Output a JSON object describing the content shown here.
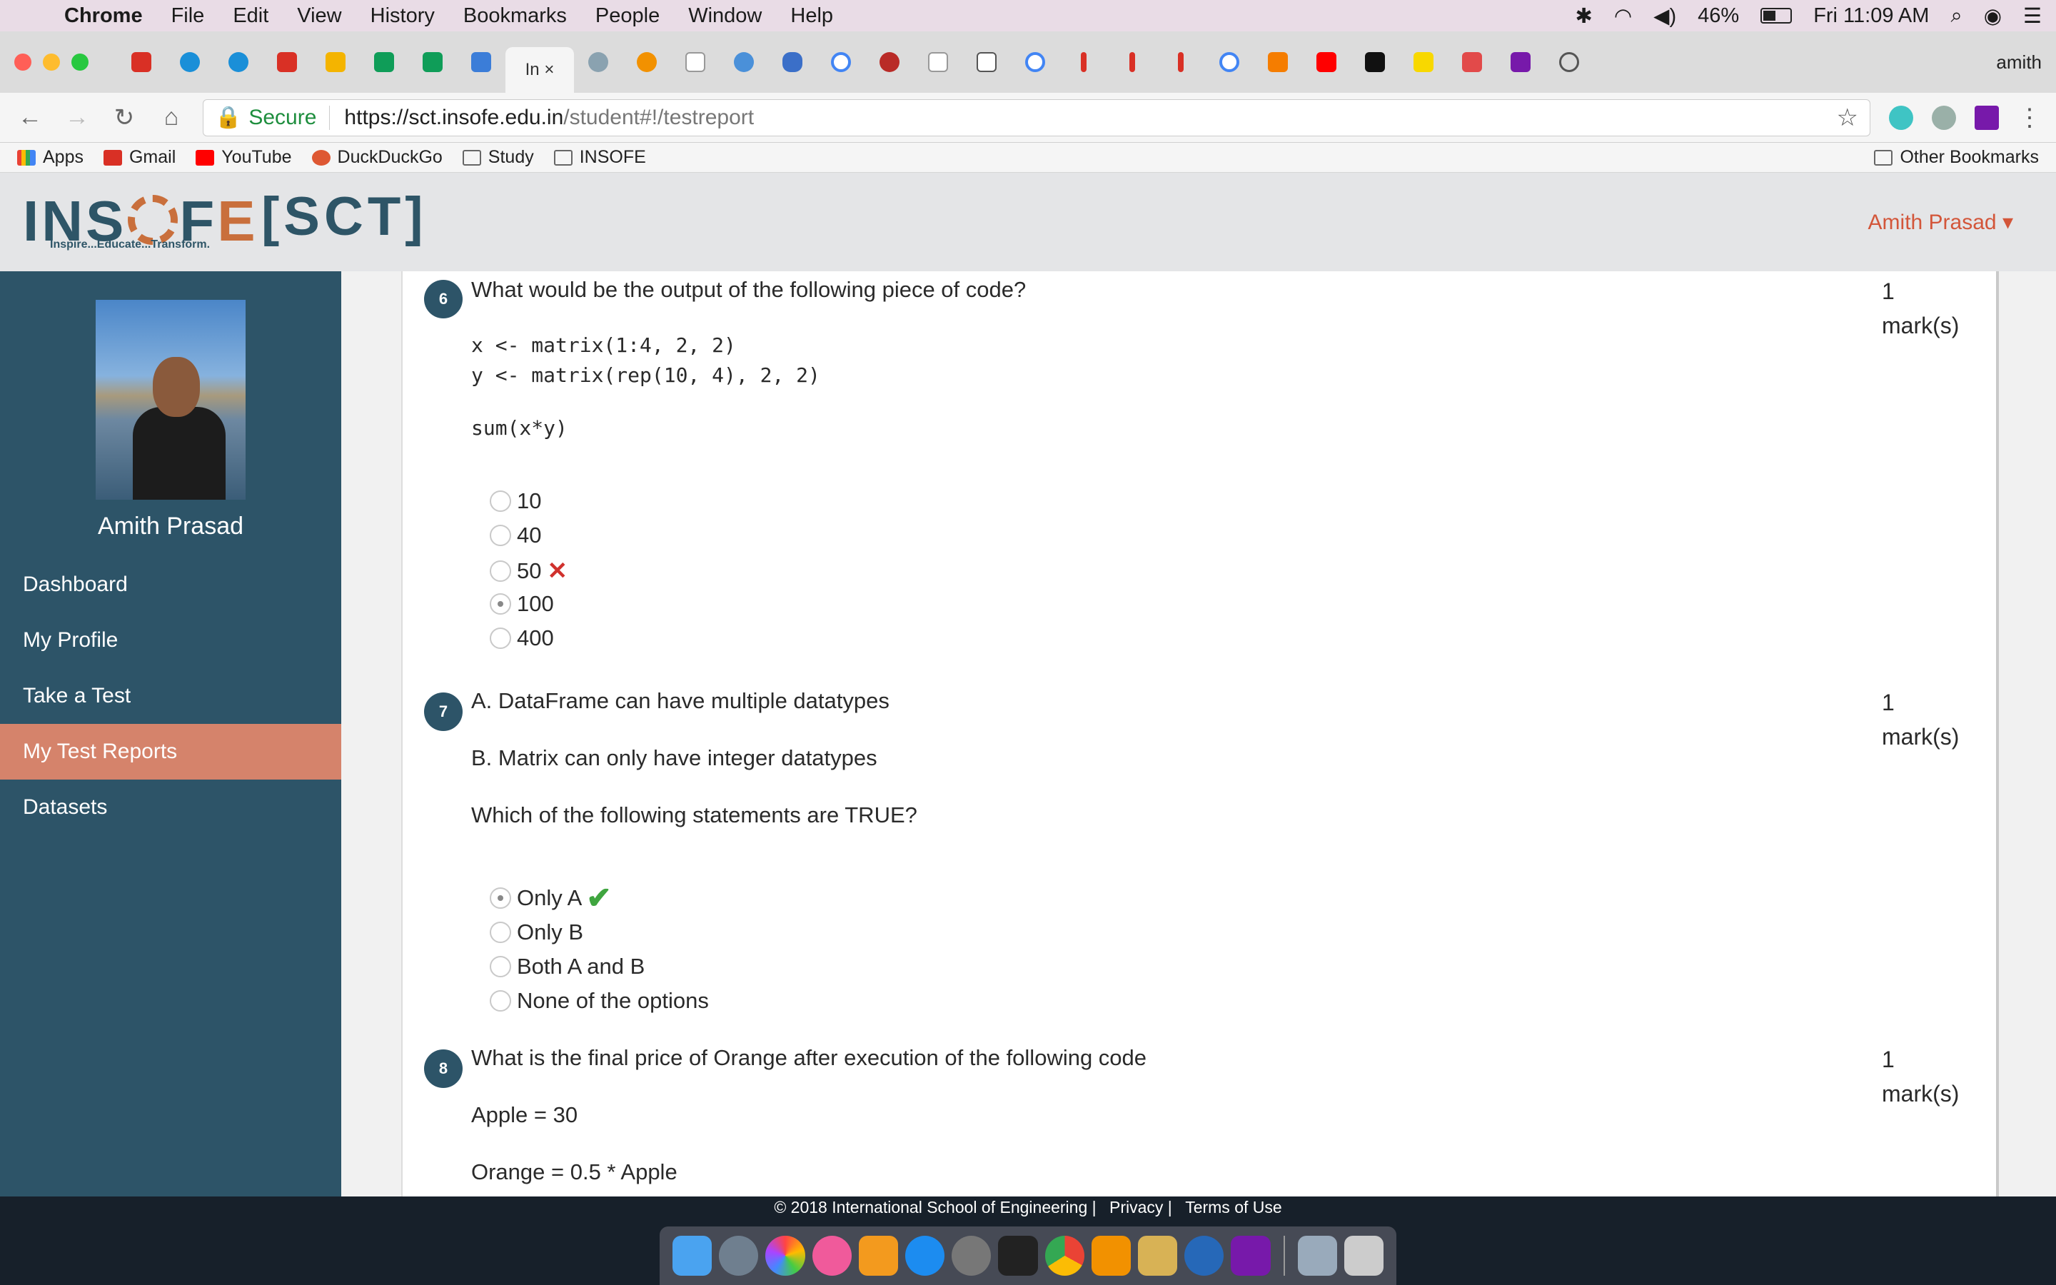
{
  "menubar": {
    "items": [
      "Chrome",
      "File",
      "Edit",
      "View",
      "History",
      "Bookmarks",
      "People",
      "Window",
      "Help"
    ],
    "battery": "46%",
    "battery_level": 0.46,
    "clock": "Fri 11:09 AM"
  },
  "browser": {
    "active_tab": "In ×",
    "profile": "amith",
    "secure_label": "Secure",
    "url_host": "https://sct.insofe.edu.in",
    "url_path": "/student#!/testreport"
  },
  "bookmarks": [
    "Apps",
    "Gmail",
    "YouTube",
    "DuckDuckGo",
    "Study",
    "INSOFE"
  ],
  "other_bookmarks": "Other Bookmarks",
  "site": {
    "logo_left": "INS",
    "logo_right": "F",
    "logo_e": "E",
    "tagline": "Inspire...Educate...Transform.",
    "sct": "[SCT]",
    "user": "Amith Prasad ▾"
  },
  "sidebar": {
    "name": "Amith Prasad",
    "items": [
      {
        "label": "Dashboard",
        "active": false
      },
      {
        "label": "My Profile",
        "active": false
      },
      {
        "label": "Take a Test",
        "active": false
      },
      {
        "label": "My Test Reports",
        "active": true
      },
      {
        "label": "Datasets",
        "active": false
      }
    ]
  },
  "questions": [
    {
      "number": "6",
      "text": "What would be the output of the following piece of code?",
      "code1": "x <- matrix(1:4, 2, 2)",
      "code2": "y <- matrix(rep(10, 4), 2, 2)",
      "code3": "sum(x*y)",
      "marks_value": "1",
      "marks_unit": "mark(s)",
      "options": [
        "10",
        "40",
        "50",
        "100",
        "400"
      ],
      "selected": "100",
      "wrong_mark": "✕"
    },
    {
      "number": "7",
      "line1": "A. DataFrame can have multiple datatypes",
      "line2": "B. Matrix can only have integer datatypes",
      "line3": "Which of the following statements are TRUE?",
      "marks_value": "1",
      "marks_unit": "mark(s)",
      "options": [
        "Only A",
        "Only B",
        "Both A and B",
        "None of the options"
      ],
      "selected": "Only A",
      "correct_mark": "✔"
    },
    {
      "number": "8",
      "text": "What is the final price of Orange after execution of the following code",
      "line1": "Apple = 30",
      "line2": "Orange = 0.5 * Apple",
      "marks_value": "1",
      "marks_unit": "mark(s)"
    }
  ],
  "footer": {
    "copyright": "© 2018 International School of Engineering |",
    "privacy": "Privacy |",
    "terms": "Terms of Use"
  },
  "icons": {
    "apple": "apple-logo-icon",
    "search": "spotlight-search-icon",
    "wifi": "wifi-icon",
    "bluetooth": "bluetooth-icon",
    "volume": "volume-icon"
  }
}
